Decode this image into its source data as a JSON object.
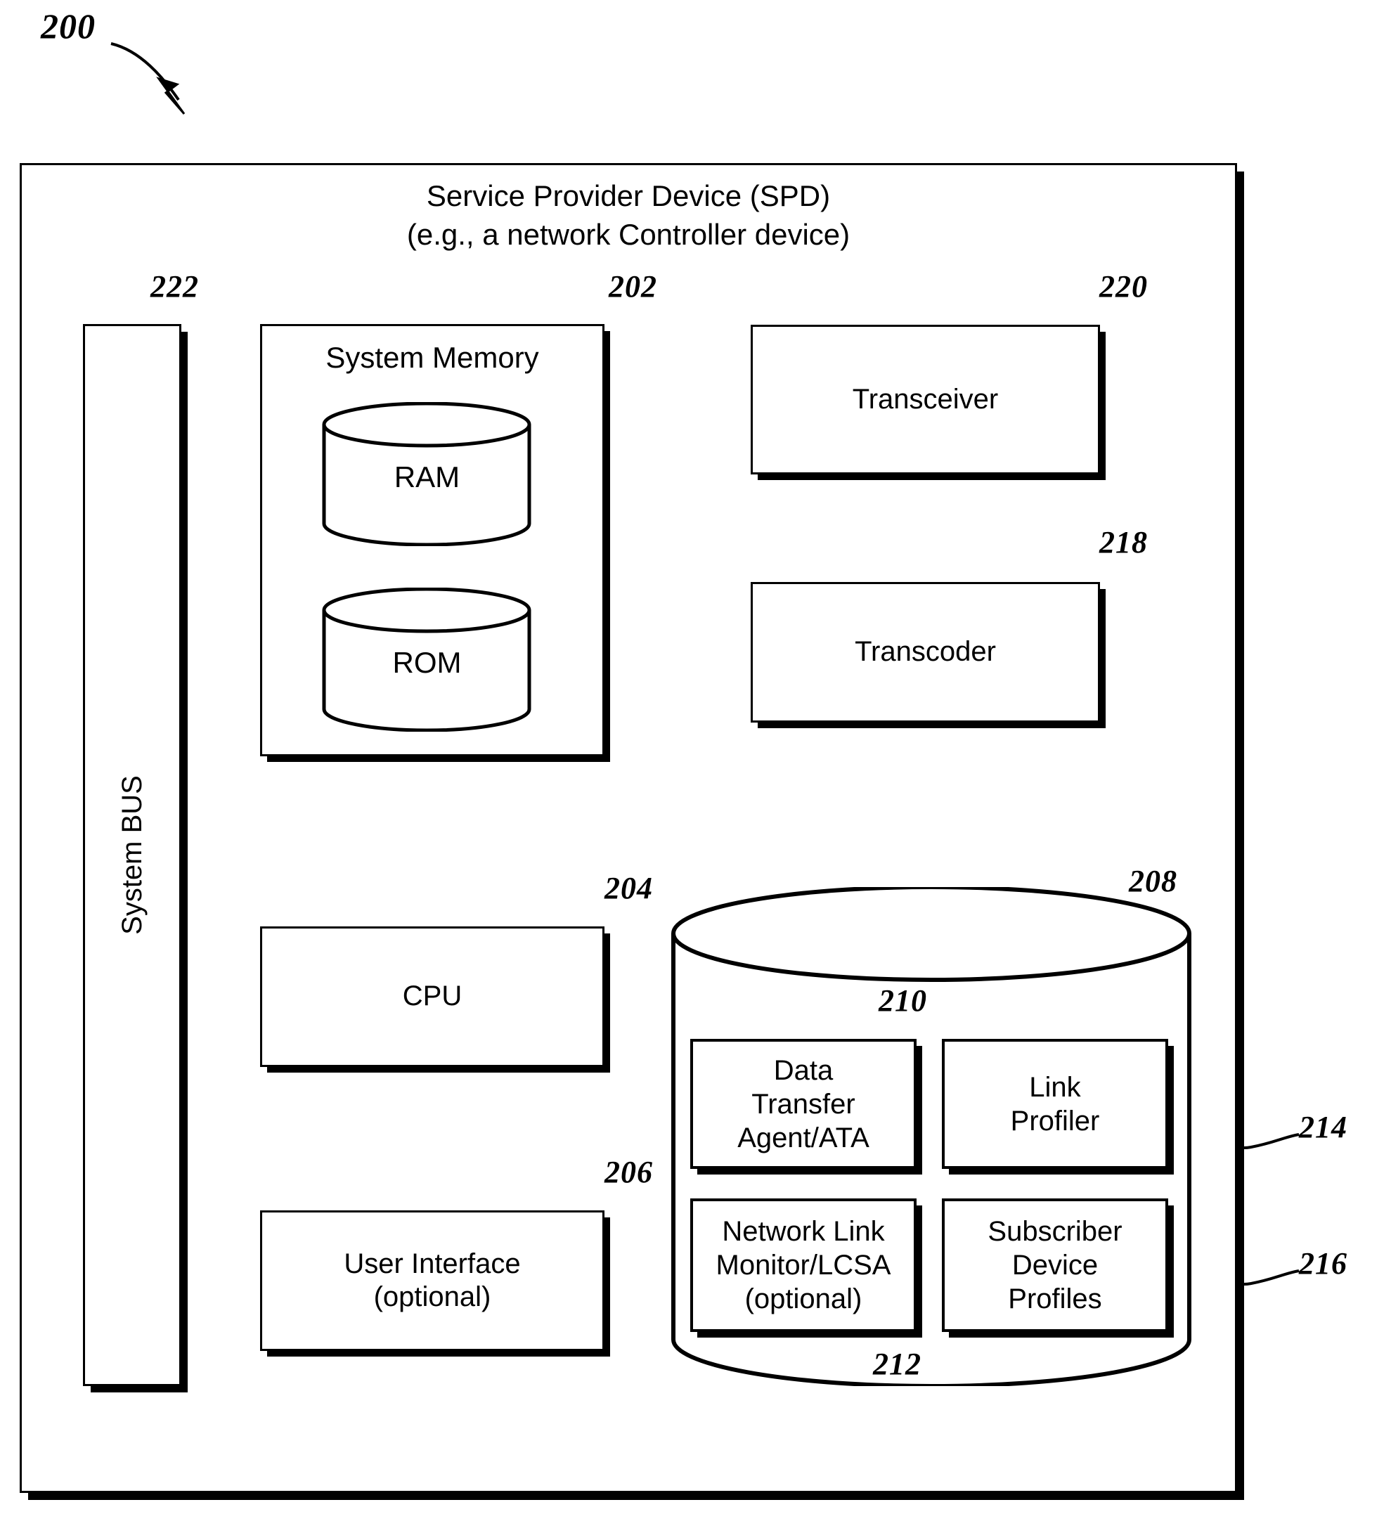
{
  "figure": {
    "figure_number": "200"
  },
  "spd": {
    "title_line1": "Service Provider Device (SPD)",
    "title_line2": "(e.g., a network Controller device)",
    "title": "Service Provider Device (SPD)\n(e.g., a network Controller device)"
  },
  "system_bus": {
    "label": "System BUS",
    "ref": "222"
  },
  "system_memory": {
    "label": "System Memory",
    "ref": "202",
    "ram": "RAM",
    "rom": "ROM"
  },
  "cpu": {
    "label": "CPU",
    "ref": "204"
  },
  "user_interface": {
    "label": "User Interface\n(optional)",
    "ref": "206"
  },
  "transceiver": {
    "label": "Transceiver",
    "ref": "220"
  },
  "transcoder": {
    "label": "Transcoder",
    "ref": "218"
  },
  "database": {
    "ref": "208",
    "items": [
      {
        "label": "Data\nTransfer\nAgent/ATA",
        "ref": "210"
      },
      {
        "label": "Link\nProfiler",
        "ref": "214"
      },
      {
        "label": "Network Link\nMonitor/LCSA\n(optional)",
        "ref": "212"
      },
      {
        "label": "Subscriber\nDevice\nProfiles",
        "ref": "216"
      }
    ]
  },
  "colors": {
    "line": "#000000",
    "background": "#ffffff"
  }
}
